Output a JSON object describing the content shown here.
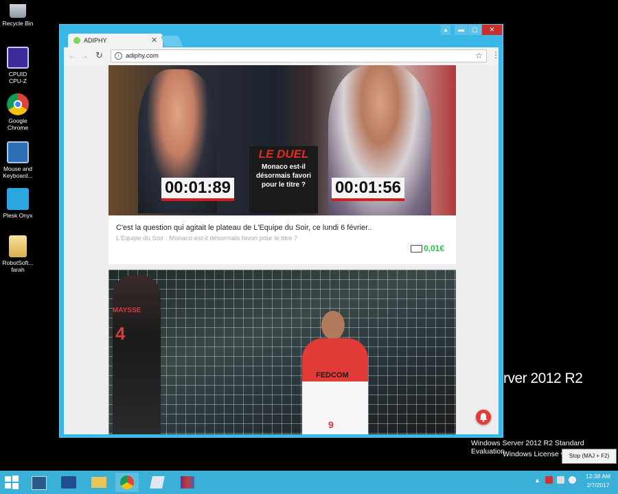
{
  "desktop": {
    "icons": [
      {
        "label": "Recycle Bin"
      },
      {
        "label": "CPUID CPU-Z"
      },
      {
        "label": "Google Chrome"
      },
      {
        "label": "Mouse and Keyboard..."
      },
      {
        "label": "Plesk Onyx"
      },
      {
        "label": "RobotSoft... farah"
      }
    ],
    "watermark": {
      "os_fragment": "rver 2012 R2",
      "line1": "Windows Server 2012 R2 Standard Evaluation",
      "line2": "Windows License v"
    },
    "stop_popup": "Stop (MAJ + F2)"
  },
  "browser": {
    "tab_title": "ADIPHY",
    "url": "adiphy.com",
    "window_buttons": [
      "▴",
      "▬",
      "▢",
      "✕"
    ]
  },
  "cards": [
    {
      "timer_left": "00:01:89",
      "timer_right": "00:01:56",
      "duel_title": "LE DUEL",
      "duel_subtitle": "Monaco est-il désormais favori pour le titre ?",
      "headline": "C'est la question qui agitait le plateau de L'Equipe du Soir, ce lundi 6 février..",
      "source": "L'Equipe du Soir : Monaco est-il désormais favori pour le titre ?",
      "reward": "0,01€"
    },
    {
      "player_name": "MAYSSE",
      "player_number": "4",
      "sponsor": "FEDCOM",
      "player2_number": "9"
    }
  ],
  "taskbar": {
    "clock_time": "12:38 AM",
    "clock_date": "2/7/2017"
  },
  "colors": {
    "window_accent": "#39b7e7",
    "reward_green": "#27c24c",
    "taskbar": "#3ab0d8",
    "notification_red": "#e53935"
  }
}
